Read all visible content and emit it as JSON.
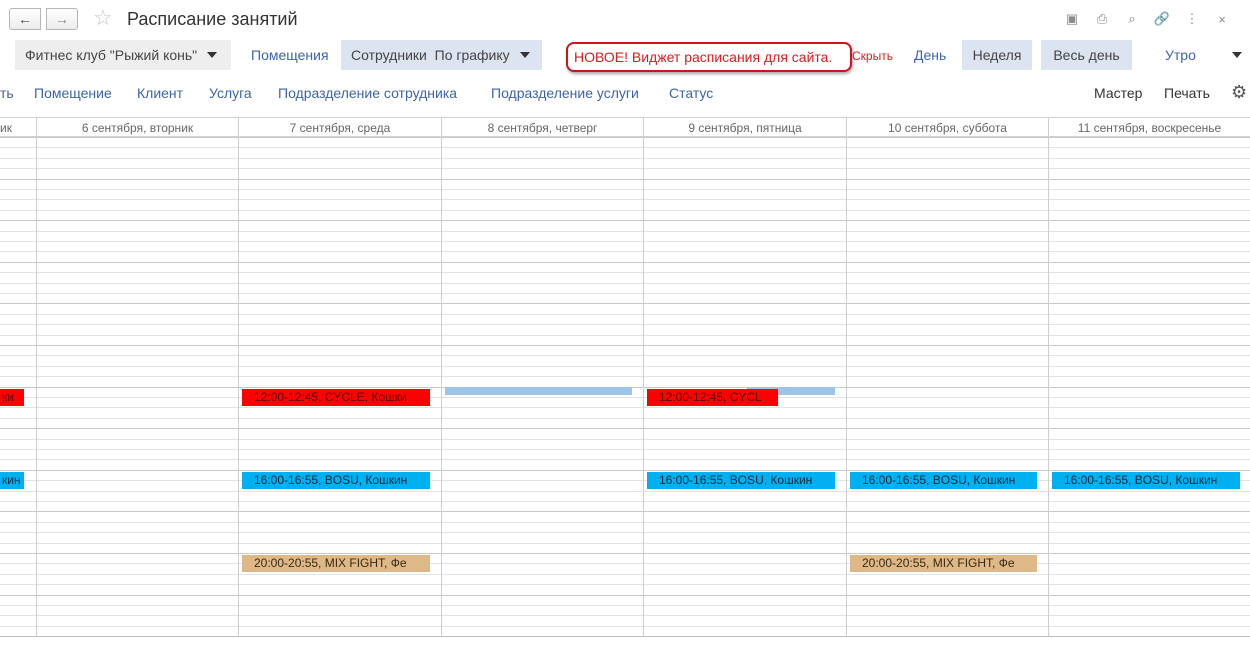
{
  "window": {
    "title": "Расписание занятий",
    "back_icon": "←",
    "forward_icon": "→",
    "star_icon": "☆",
    "icons": [
      "save-icon",
      "print-icon",
      "preview-icon",
      "link-icon",
      "more-icon",
      "close-icon"
    ],
    "icon_glyphs": [
      "▣",
      "⎙",
      "⌕",
      "🔗",
      "⋮",
      "×"
    ]
  },
  "toolbar": {
    "club": "Фитнес клуб \"Рыжий конь\"",
    "rooms": "Помещения",
    "staff": "Сотрудники",
    "by_schedule": "По графику",
    "banner": "НОВОЕ! Виджет расписания для сайта.",
    "hide": "Скрыть",
    "day": "День",
    "week": "Неделя",
    "all_day": "Весь день",
    "morning": "Утро"
  },
  "filters": {
    "cut": "ть",
    "room": "Помещение",
    "client": "Клиент",
    "service": "Услуга",
    "staff_division": "Подразделение сотрудника",
    "service_division": "Подразделение услуги",
    "status": "Статус",
    "master": "Мастер",
    "print": "Печать"
  },
  "days": [
    {
      "label": "ик"
    },
    {
      "label": "6 сентября, вторник"
    },
    {
      "label": "7 сентября, среда"
    },
    {
      "label": "8 сентября, четверг"
    },
    {
      "label": "9 сентября, пятница"
    },
    {
      "label": "10 сентября, суббота"
    },
    {
      "label": "11 сентября, воскресенье"
    }
  ],
  "events": [
    {
      "day": 0,
      "text": "ки",
      "kind": "red"
    },
    {
      "day": 2,
      "text": "12:00-12:45, CYCLE, Кошки",
      "kind": "red"
    },
    {
      "day": 4,
      "text": "12:00-12:45, CYCL",
      "kind": "red"
    },
    {
      "day": 0,
      "text": "кин",
      "kind": "cyan"
    },
    {
      "day": 2,
      "text": "16:00-16:55, BOSU, Кошкин",
      "kind": "cyan"
    },
    {
      "day": 4,
      "text": "16:00-16:55, BOSU, Кошкин",
      "kind": "cyan"
    },
    {
      "day": 5,
      "text": "16:00-16:55, BOSU, Кошкин",
      "kind": "cyan"
    },
    {
      "day": 6,
      "text": "16:00-16:55, BOSU, Кошкин",
      "kind": "cyan"
    },
    {
      "day": 2,
      "text": "20:00-20:55, MIX FIGHT, Фе",
      "kind": "tan"
    },
    {
      "day": 5,
      "text": "20:00-20:55, MIX FIGHT, Фе",
      "kind": "tan"
    }
  ],
  "colors": {
    "accent_link": "#3c64a8",
    "banner_red": "#d21e1e",
    "event_red": "#ff0000",
    "event_cyan": "#00b0f0",
    "event_tan": "#deb887",
    "event_light_blue": "#9dc3e6"
  }
}
